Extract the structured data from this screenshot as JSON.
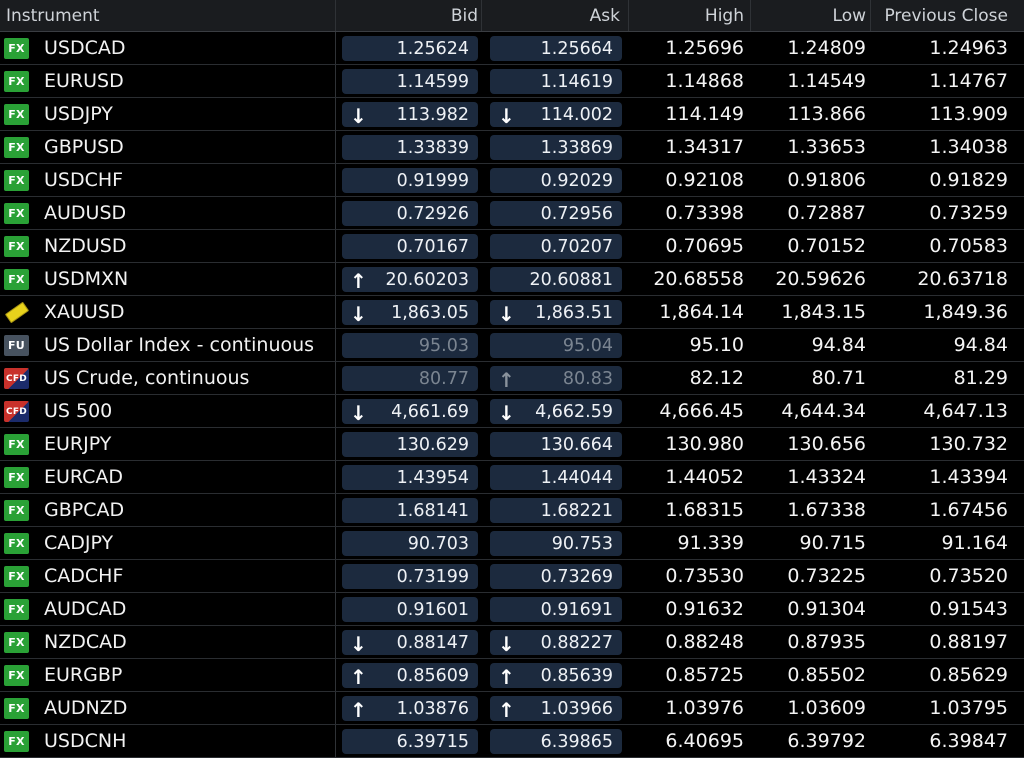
{
  "headers": {
    "instrument": "Instrument",
    "bid": "Bid",
    "ask": "Ask",
    "high": "High",
    "low": "Low",
    "prev": "Previous Close"
  },
  "colors": {
    "background": "#000000",
    "quote_box": "#1c2a3e",
    "fx_badge": "#2aa136",
    "fu_badge": "#47525f",
    "gold": "#e8d21c"
  },
  "rows": [
    {
      "icon": "FX",
      "name": "USDCAD",
      "bid": "1.25624",
      "ask": "1.25664",
      "bid_arrow": "",
      "ask_arrow": "",
      "high": "1.25696",
      "low": "1.24809",
      "prev": "1.24963",
      "muted": false
    },
    {
      "icon": "FX",
      "name": "EURUSD",
      "bid": "1.14599",
      "ask": "1.14619",
      "bid_arrow": "",
      "ask_arrow": "",
      "high": "1.14868",
      "low": "1.14549",
      "prev": "1.14767",
      "muted": false
    },
    {
      "icon": "FX",
      "name": "USDJPY",
      "bid": "113.982",
      "ask": "114.002",
      "bid_arrow": "↓",
      "ask_arrow": "↓",
      "high": "114.149",
      "low": "113.866",
      "prev": "113.909",
      "muted": false
    },
    {
      "icon": "FX",
      "name": "GBPUSD",
      "bid": "1.33839",
      "ask": "1.33869",
      "bid_arrow": "",
      "ask_arrow": "",
      "high": "1.34317",
      "low": "1.33653",
      "prev": "1.34038",
      "muted": false
    },
    {
      "icon": "FX",
      "name": "USDCHF",
      "bid": "0.91999",
      "ask": "0.92029",
      "bid_arrow": "",
      "ask_arrow": "",
      "high": "0.92108",
      "low": "0.91806",
      "prev": "0.91829",
      "muted": false
    },
    {
      "icon": "FX",
      "name": "AUDUSD",
      "bid": "0.72926",
      "ask": "0.72956",
      "bid_arrow": "",
      "ask_arrow": "",
      "high": "0.73398",
      "low": "0.72887",
      "prev": "0.73259",
      "muted": false
    },
    {
      "icon": "FX",
      "name": "NZDUSD",
      "bid": "0.70167",
      "ask": "0.70207",
      "bid_arrow": "",
      "ask_arrow": "",
      "high": "0.70695",
      "low": "0.70152",
      "prev": "0.70583",
      "muted": false
    },
    {
      "icon": "FX",
      "name": "USDMXN",
      "bid": "20.60203",
      "ask": "20.60881",
      "bid_arrow": "↑",
      "ask_arrow": "",
      "high": "20.68558",
      "low": "20.59626",
      "prev": "20.63718",
      "muted": false
    },
    {
      "icon": "GOLD",
      "name": "XAUUSD",
      "bid": "1,863.05",
      "ask": "1,863.51",
      "bid_arrow": "↓",
      "ask_arrow": "↓",
      "high": "1,864.14",
      "low": "1,843.15",
      "prev": "1,849.36",
      "muted": false
    },
    {
      "icon": "FU",
      "name": "US Dollar Index - continuous",
      "bid": "95.03",
      "ask": "95.04",
      "bid_arrow": "",
      "ask_arrow": "",
      "high": "95.10",
      "low": "94.84",
      "prev": "94.84",
      "muted": true
    },
    {
      "icon": "CFD",
      "name": "US Crude, continuous",
      "bid": "80.77",
      "ask": "80.83",
      "bid_arrow": "",
      "ask_arrow": "↑",
      "high": "82.12",
      "low": "80.71",
      "prev": "81.29",
      "muted": true
    },
    {
      "icon": "CFD",
      "name": "US 500",
      "bid": "4,661.69",
      "ask": "4,662.59",
      "bid_arrow": "↓",
      "ask_arrow": "↓",
      "high": "4,666.45",
      "low": "4,644.34",
      "prev": "4,647.13",
      "muted": false
    },
    {
      "icon": "FX",
      "name": "EURJPY",
      "bid": "130.629",
      "ask": "130.664",
      "bid_arrow": "",
      "ask_arrow": "",
      "high": "130.980",
      "low": "130.656",
      "prev": "130.732",
      "muted": false
    },
    {
      "icon": "FX",
      "name": "EURCAD",
      "bid": "1.43954",
      "ask": "1.44044",
      "bid_arrow": "",
      "ask_arrow": "",
      "high": "1.44052",
      "low": "1.43324",
      "prev": "1.43394",
      "muted": false
    },
    {
      "icon": "FX",
      "name": "GBPCAD",
      "bid": "1.68141",
      "ask": "1.68221",
      "bid_arrow": "",
      "ask_arrow": "",
      "high": "1.68315",
      "low": "1.67338",
      "prev": "1.67456",
      "muted": false
    },
    {
      "icon": "FX",
      "name": "CADJPY",
      "bid": "90.703",
      "ask": "90.753",
      "bid_arrow": "",
      "ask_arrow": "",
      "high": "91.339",
      "low": "90.715",
      "prev": "91.164",
      "muted": false
    },
    {
      "icon": "FX",
      "name": "CADCHF",
      "bid": "0.73199",
      "ask": "0.73269",
      "bid_arrow": "",
      "ask_arrow": "",
      "high": "0.73530",
      "low": "0.73225",
      "prev": "0.73520",
      "muted": false
    },
    {
      "icon": "FX",
      "name": "AUDCAD",
      "bid": "0.91601",
      "ask": "0.91691",
      "bid_arrow": "",
      "ask_arrow": "",
      "high": "0.91632",
      "low": "0.91304",
      "prev": "0.91543",
      "muted": false
    },
    {
      "icon": "FX",
      "name": "NZDCAD",
      "bid": "0.88147",
      "ask": "0.88227",
      "bid_arrow": "↓",
      "ask_arrow": "↓",
      "high": "0.88248",
      "low": "0.87935",
      "prev": "0.88197",
      "muted": false
    },
    {
      "icon": "FX",
      "name": "EURGBP",
      "bid": "0.85609",
      "ask": "0.85639",
      "bid_arrow": "↑",
      "ask_arrow": "↑",
      "high": "0.85725",
      "low": "0.85502",
      "prev": "0.85629",
      "muted": false
    },
    {
      "icon": "FX",
      "name": "AUDNZD",
      "bid": "1.03876",
      "ask": "1.03966",
      "bid_arrow": "↑",
      "ask_arrow": "↑",
      "high": "1.03976",
      "low": "1.03609",
      "prev": "1.03795",
      "muted": false
    },
    {
      "icon": "FX",
      "name": "USDCNH",
      "bid": "6.39715",
      "ask": "6.39865",
      "bid_arrow": "",
      "ask_arrow": "",
      "high": "6.40695",
      "low": "6.39792",
      "prev": "6.39847",
      "muted": false
    }
  ]
}
